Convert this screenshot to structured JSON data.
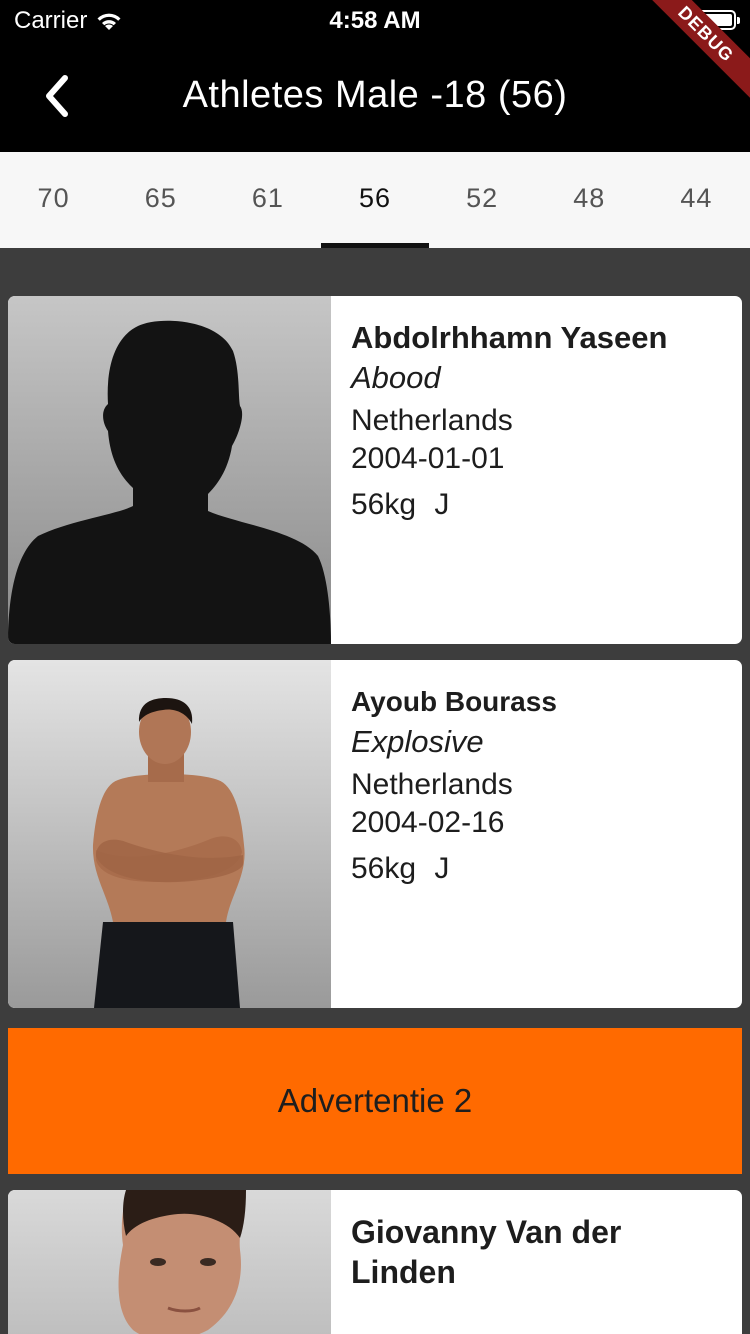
{
  "status": {
    "carrier": "Carrier",
    "time": "4:58 AM"
  },
  "debug_label": "DEBUG",
  "app_bar": {
    "title": "Athletes Male -18 (56)"
  },
  "tabs": [
    "70",
    "65",
    "61",
    "56",
    "52",
    "48",
    "44"
  ],
  "active_tab": "56",
  "athletes": [
    {
      "name": "Abdolrhhamn Yaseen",
      "nickname": "Abood",
      "country": "Netherlands",
      "dob": "2004-01-01",
      "weight": "56kg",
      "category": "J"
    },
    {
      "name": "Ayoub Bourass",
      "nickname": "Explosive",
      "country": "Netherlands",
      "dob": "2004-02-16",
      "weight": "56kg",
      "category": "J"
    },
    {
      "name": "Giovanny Van der Linden"
    }
  ],
  "ad": {
    "label": "Advertentie 2",
    "color": "#ff6a00"
  }
}
